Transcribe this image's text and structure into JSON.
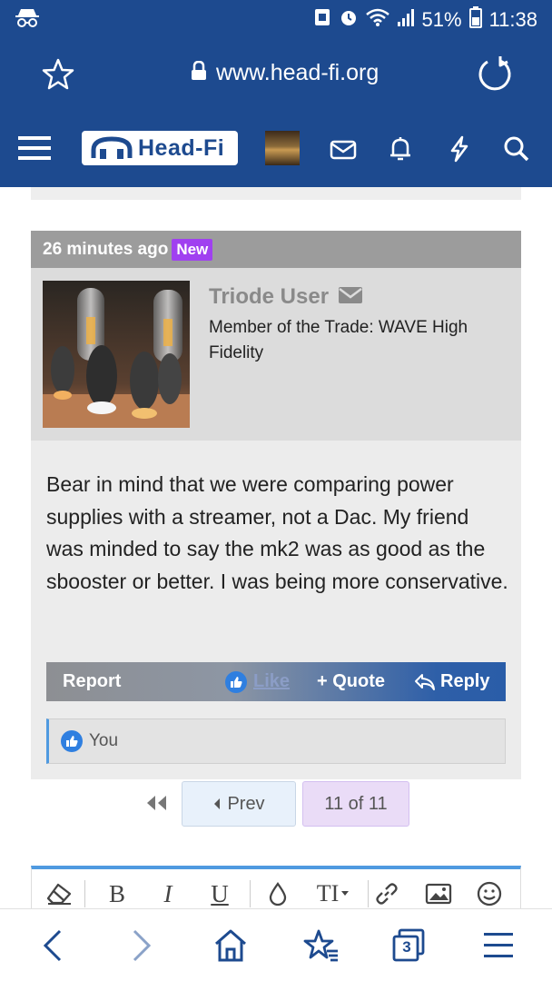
{
  "status_bar": {
    "battery": "51%",
    "time": "11:38",
    "icons": [
      "incognito-icon",
      "screenshot-icon",
      "alarm-icon",
      "wifi-icon",
      "signal-icon",
      "battery-icon"
    ]
  },
  "browser": {
    "url": "www.head-fi.org",
    "icons": [
      "star-icon",
      "lock-icon",
      "reload-icon"
    ]
  },
  "site_header": {
    "logo_text": "Head-Fi",
    "icons": [
      "menu-icon",
      "mail-icon",
      "bell-icon",
      "bolt-icon",
      "search-icon"
    ]
  },
  "post": {
    "time": "26 minutes ago",
    "badge": "New",
    "username": "Triode User",
    "user_title": "Member of the Trade: WAVE High Fidelity",
    "message": "Bear in mind that we were comparing power supplies with a streamer, not a Dac. My friend was minded to say the mk2 was as good as the sbooster or better. I was being more conservative.",
    "actions": {
      "report": "Report",
      "like": "Like",
      "quote": "+ Quote",
      "reply": "Reply"
    },
    "likes": "You"
  },
  "pager": {
    "prev": "Prev",
    "current": "11 of 11"
  },
  "editor": {
    "bold": "B",
    "italic": "I",
    "underline": "U",
    "text_size": "TI",
    "icons": [
      "eraser-icon",
      "color-icon",
      "text-size-icon",
      "link-icon",
      "image-icon",
      "smiley-icon"
    ]
  },
  "bottom_nav": {
    "tabs_count": "3",
    "icons": [
      "back-icon",
      "forward-icon",
      "home-icon",
      "bookmarks-icon",
      "tabs-icon",
      "menu-icon"
    ]
  },
  "colors": {
    "header_blue": "#1d4a8f",
    "new_badge": "#a040f0",
    "like_blue": "#2f7fe0",
    "pager_current": "#eadcf7"
  }
}
